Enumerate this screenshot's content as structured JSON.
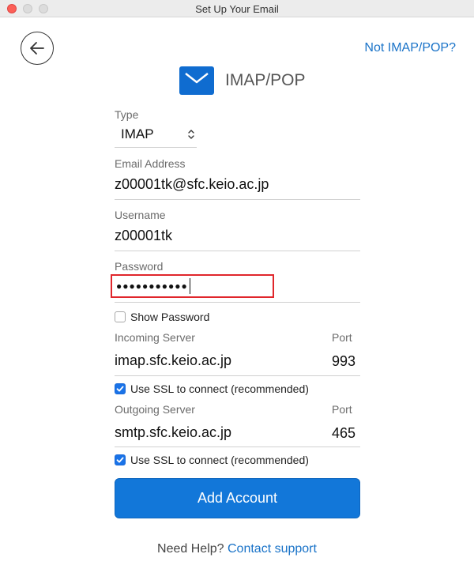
{
  "window": {
    "title": "Set Up Your Email"
  },
  "header": {
    "not_imap_link": "Not IMAP/POP?",
    "title": "IMAP/POP"
  },
  "form": {
    "type": {
      "label": "Type",
      "value": "IMAP"
    },
    "email": {
      "label": "Email Address",
      "value": "z00001tk@sfc.keio.ac.jp"
    },
    "username": {
      "label": "Username",
      "value": "z00001tk"
    },
    "password": {
      "label": "Password",
      "value": "●●●●●●●●●●●"
    },
    "show_password": {
      "label": "Show Password",
      "checked": false
    },
    "incoming": {
      "label": "Incoming Server",
      "port_label": "Port",
      "server": "imap.sfc.keio.ac.jp",
      "port": "993",
      "ssl_label": "Use SSL to connect (recommended)",
      "ssl_checked": true
    },
    "outgoing": {
      "label": "Outgoing Server",
      "port_label": "Port",
      "server": "smtp.sfc.keio.ac.jp",
      "port": "465",
      "ssl_label": "Use SSL to connect (recommended)",
      "ssl_checked": true
    }
  },
  "actions": {
    "add_account": "Add Account"
  },
  "help": {
    "prefix": "Need Help?",
    "link": "Contact support"
  },
  "icons": {
    "back": "back-arrow-icon",
    "mail": "envelope-icon",
    "select": "chevron-updown-icon",
    "check": "checkmark-icon"
  },
  "colors": {
    "accent": "#1277d9",
    "link": "#1a73c8",
    "focus_outline": "#e0262b"
  }
}
